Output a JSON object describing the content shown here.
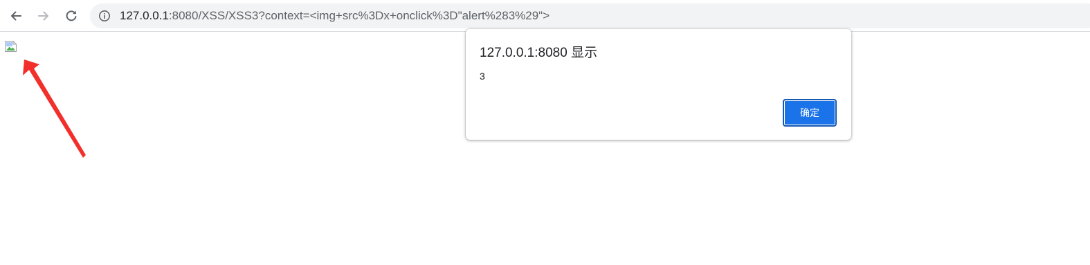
{
  "browser": {
    "url_host": "127.0.0.1",
    "url_rest": ":8080/XSS/XSS3?context=<img+src%3Dx+onclick%3D\"alert%283%29\">",
    "icons": {
      "back": "arrow-left-icon",
      "forward": "arrow-right-icon",
      "reload": "reload-icon",
      "site_info": "info-icon"
    }
  },
  "alert_dialog": {
    "title": "127.0.0.1:8080 显示",
    "message": "3",
    "ok_label": "确定"
  },
  "colors": {
    "accent": "#1a73e8",
    "annotation_arrow": "#f2302b"
  }
}
